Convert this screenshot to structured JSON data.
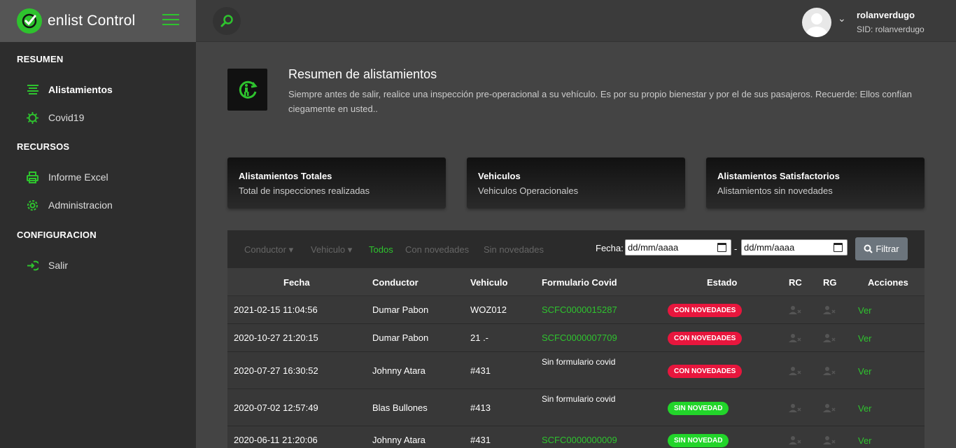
{
  "brand": {
    "name": "enlist Control"
  },
  "sidebar": {
    "sections": [
      {
        "title": "RESUMEN",
        "items": [
          {
            "label": "Alistamientos",
            "icon": "list-icon"
          },
          {
            "label": "Covid19",
            "icon": "virus-icon"
          }
        ]
      },
      {
        "title": "RECURSOS",
        "items": [
          {
            "label": "Informe Excel",
            "icon": "printer-icon"
          },
          {
            "label": "Administracion",
            "icon": "gear-icon"
          }
        ]
      },
      {
        "title": "CONFIGURACION",
        "items": [
          {
            "label": "Salir",
            "icon": "logout-icon"
          }
        ]
      }
    ]
  },
  "topbar": {
    "user_name": "rolanverdugo",
    "user_sid": "SID: rolanverdugo"
  },
  "header": {
    "title": "Resumen de alistamientos",
    "description": "Siempre antes de salir, realice una inspección pre-operacional a su vehículo. Es por su propio bienestar y por el de sus pasajeros. Recuerde: Ellos confían ciegamente en usted.."
  },
  "cards": [
    {
      "title": "Alistamientos Totales",
      "subtitle": "Total de inspecciones realizadas"
    },
    {
      "title": "Vehiculos",
      "subtitle": "Vehiculos Operacionales"
    },
    {
      "title": "Alistamientos Satisfactorios",
      "subtitle": "Alistamientos sin novedades"
    }
  ],
  "filters": {
    "conductor": "Conductor ▾",
    "vehiculo": "Vehiculo ▾",
    "todos": "Todos",
    "con_novedades": "Con novedades",
    "sin_novedades": "Sin novedades",
    "fecha_label": "Fecha:",
    "date_placeholder_1": "dd/mm/aaaa",
    "date_placeholder_2": "dd/mm/aaaa",
    "date_sep": "-",
    "filter_button": "Filtrar"
  },
  "table": {
    "headers": {
      "fecha": "Fecha",
      "conductor": "Conductor",
      "vehiculo": "Vehiculo",
      "formulario": "Formulario Covid",
      "estado": "Estado",
      "rc": "RC",
      "rg": "RG",
      "acciones": "Acciones"
    },
    "rows": [
      {
        "fecha": "2021-02-15 11:04:56",
        "conductor": "Dumar Pabon",
        "vehiculo": "WOZ012",
        "formulario": "SCFC0000015287",
        "estado": "CON NOVEDADES",
        "accion": "Ver"
      },
      {
        "fecha": "2020-10-27 21:20:15",
        "conductor": "Dumar Pabon",
        "vehiculo": "21 .-",
        "formulario": "SCFC0000007709",
        "estado": "CON NOVEDADES",
        "accion": "Ver"
      },
      {
        "fecha": "2020-07-27 16:30:52",
        "conductor": "Johnny Atara",
        "vehiculo": "#431",
        "formulario": "Sin formulario covid",
        "estado": "CON NOVEDADES",
        "accion": "Ver"
      },
      {
        "fecha": "2020-07-02 12:57:49",
        "conductor": "Blas Bullones",
        "vehiculo": "#413",
        "formulario": "Sin formulario covid",
        "estado": "SIN NOVEDAD",
        "accion": "Ver"
      },
      {
        "fecha": "2020-06-11 21:20:06",
        "conductor": "Johnny Atara",
        "vehiculo": "#431",
        "formulario": "SCFC0000000009",
        "estado": "SIN NOVEDAD",
        "accion": "Ver"
      }
    ]
  },
  "colors": {
    "accent": "#2ec32e",
    "danger": "#e8163d",
    "success": "#22d52a"
  }
}
